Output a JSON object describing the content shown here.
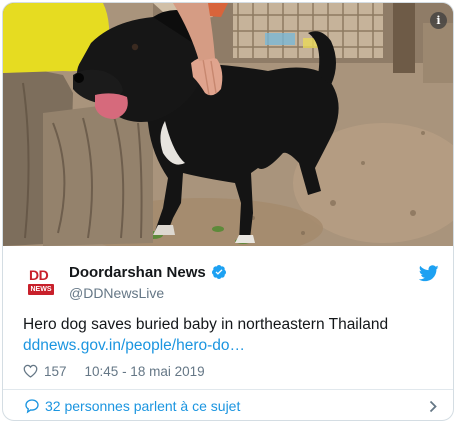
{
  "media": {
    "info_icon": "info-icon",
    "info_glyph": "i"
  },
  "author": {
    "avatar_top": "DD",
    "avatar_bottom": "NEWS",
    "name": "Doordarshan News",
    "handle": "@DDNewsLive",
    "verified_icon": "verified-badge-icon",
    "brand_icon": "twitter-bird-icon"
  },
  "tweet": {
    "text": "Hero dog saves buried baby in northeastern Thailand",
    "link": "ddnews.gov.in/people/hero-do…",
    "likes": "157",
    "timestamp": "10:45 - 18 mai 2019"
  },
  "footer": {
    "label": "32 personnes parlent à ce sujet"
  },
  "colors": {
    "link": "#1b95e0",
    "text": "#14171a",
    "muted": "#657786",
    "brand_red": "#c8202b",
    "border": "#e1e8ed"
  }
}
